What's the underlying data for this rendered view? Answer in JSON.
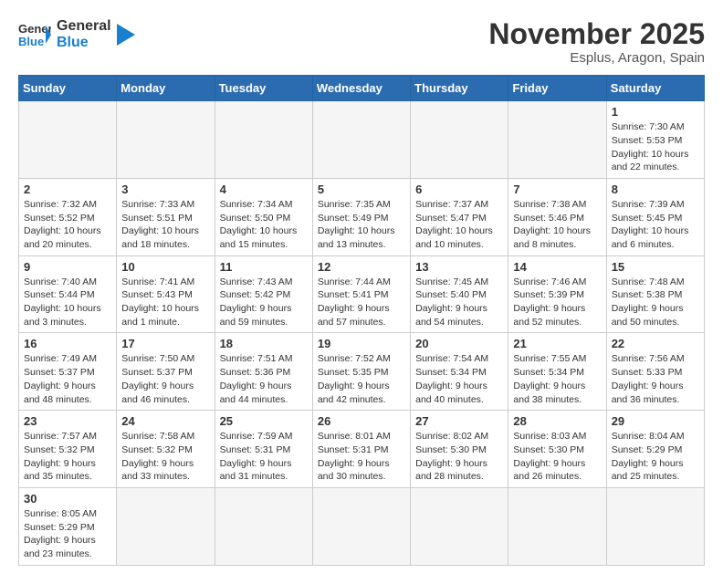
{
  "header": {
    "logo_general": "General",
    "logo_blue": "Blue",
    "month_title": "November 2025",
    "location": "Esplus, Aragon, Spain"
  },
  "days_of_week": [
    "Sunday",
    "Monday",
    "Tuesday",
    "Wednesday",
    "Thursday",
    "Friday",
    "Saturday"
  ],
  "weeks": [
    [
      {
        "day": "",
        "info": ""
      },
      {
        "day": "",
        "info": ""
      },
      {
        "day": "",
        "info": ""
      },
      {
        "day": "",
        "info": ""
      },
      {
        "day": "",
        "info": ""
      },
      {
        "day": "",
        "info": ""
      },
      {
        "day": "1",
        "info": "Sunrise: 7:30 AM\nSunset: 5:53 PM\nDaylight: 10 hours and 22 minutes."
      }
    ],
    [
      {
        "day": "2",
        "info": "Sunrise: 7:32 AM\nSunset: 5:52 PM\nDaylight: 10 hours and 20 minutes."
      },
      {
        "day": "3",
        "info": "Sunrise: 7:33 AM\nSunset: 5:51 PM\nDaylight: 10 hours and 18 minutes."
      },
      {
        "day": "4",
        "info": "Sunrise: 7:34 AM\nSunset: 5:50 PM\nDaylight: 10 hours and 15 minutes."
      },
      {
        "day": "5",
        "info": "Sunrise: 7:35 AM\nSunset: 5:49 PM\nDaylight: 10 hours and 13 minutes."
      },
      {
        "day": "6",
        "info": "Sunrise: 7:37 AM\nSunset: 5:47 PM\nDaylight: 10 hours and 10 minutes."
      },
      {
        "day": "7",
        "info": "Sunrise: 7:38 AM\nSunset: 5:46 PM\nDaylight: 10 hours and 8 minutes."
      },
      {
        "day": "8",
        "info": "Sunrise: 7:39 AM\nSunset: 5:45 PM\nDaylight: 10 hours and 6 minutes."
      }
    ],
    [
      {
        "day": "9",
        "info": "Sunrise: 7:40 AM\nSunset: 5:44 PM\nDaylight: 10 hours and 3 minutes."
      },
      {
        "day": "10",
        "info": "Sunrise: 7:41 AM\nSunset: 5:43 PM\nDaylight: 10 hours and 1 minute."
      },
      {
        "day": "11",
        "info": "Sunrise: 7:43 AM\nSunset: 5:42 PM\nDaylight: 9 hours and 59 minutes."
      },
      {
        "day": "12",
        "info": "Sunrise: 7:44 AM\nSunset: 5:41 PM\nDaylight: 9 hours and 57 minutes."
      },
      {
        "day": "13",
        "info": "Sunrise: 7:45 AM\nSunset: 5:40 PM\nDaylight: 9 hours and 54 minutes."
      },
      {
        "day": "14",
        "info": "Sunrise: 7:46 AM\nSunset: 5:39 PM\nDaylight: 9 hours and 52 minutes."
      },
      {
        "day": "15",
        "info": "Sunrise: 7:48 AM\nSunset: 5:38 PM\nDaylight: 9 hours and 50 minutes."
      }
    ],
    [
      {
        "day": "16",
        "info": "Sunrise: 7:49 AM\nSunset: 5:37 PM\nDaylight: 9 hours and 48 minutes."
      },
      {
        "day": "17",
        "info": "Sunrise: 7:50 AM\nSunset: 5:37 PM\nDaylight: 9 hours and 46 minutes."
      },
      {
        "day": "18",
        "info": "Sunrise: 7:51 AM\nSunset: 5:36 PM\nDaylight: 9 hours and 44 minutes."
      },
      {
        "day": "19",
        "info": "Sunrise: 7:52 AM\nSunset: 5:35 PM\nDaylight: 9 hours and 42 minutes."
      },
      {
        "day": "20",
        "info": "Sunrise: 7:54 AM\nSunset: 5:34 PM\nDaylight: 9 hours and 40 minutes."
      },
      {
        "day": "21",
        "info": "Sunrise: 7:55 AM\nSunset: 5:34 PM\nDaylight: 9 hours and 38 minutes."
      },
      {
        "day": "22",
        "info": "Sunrise: 7:56 AM\nSunset: 5:33 PM\nDaylight: 9 hours and 36 minutes."
      }
    ],
    [
      {
        "day": "23",
        "info": "Sunrise: 7:57 AM\nSunset: 5:32 PM\nDaylight: 9 hours and 35 minutes."
      },
      {
        "day": "24",
        "info": "Sunrise: 7:58 AM\nSunset: 5:32 PM\nDaylight: 9 hours and 33 minutes."
      },
      {
        "day": "25",
        "info": "Sunrise: 7:59 AM\nSunset: 5:31 PM\nDaylight: 9 hours and 31 minutes."
      },
      {
        "day": "26",
        "info": "Sunrise: 8:01 AM\nSunset: 5:31 PM\nDaylight: 9 hours and 30 minutes."
      },
      {
        "day": "27",
        "info": "Sunrise: 8:02 AM\nSunset: 5:30 PM\nDaylight: 9 hours and 28 minutes."
      },
      {
        "day": "28",
        "info": "Sunrise: 8:03 AM\nSunset: 5:30 PM\nDaylight: 9 hours and 26 minutes."
      },
      {
        "day": "29",
        "info": "Sunrise: 8:04 AM\nSunset: 5:29 PM\nDaylight: 9 hours and 25 minutes."
      }
    ],
    [
      {
        "day": "30",
        "info": "Sunrise: 8:05 AM\nSunset: 5:29 PM\nDaylight: 9 hours and 23 minutes."
      },
      {
        "day": "",
        "info": ""
      },
      {
        "day": "",
        "info": ""
      },
      {
        "day": "",
        "info": ""
      },
      {
        "day": "",
        "info": ""
      },
      {
        "day": "",
        "info": ""
      },
      {
        "day": "",
        "info": ""
      }
    ]
  ]
}
